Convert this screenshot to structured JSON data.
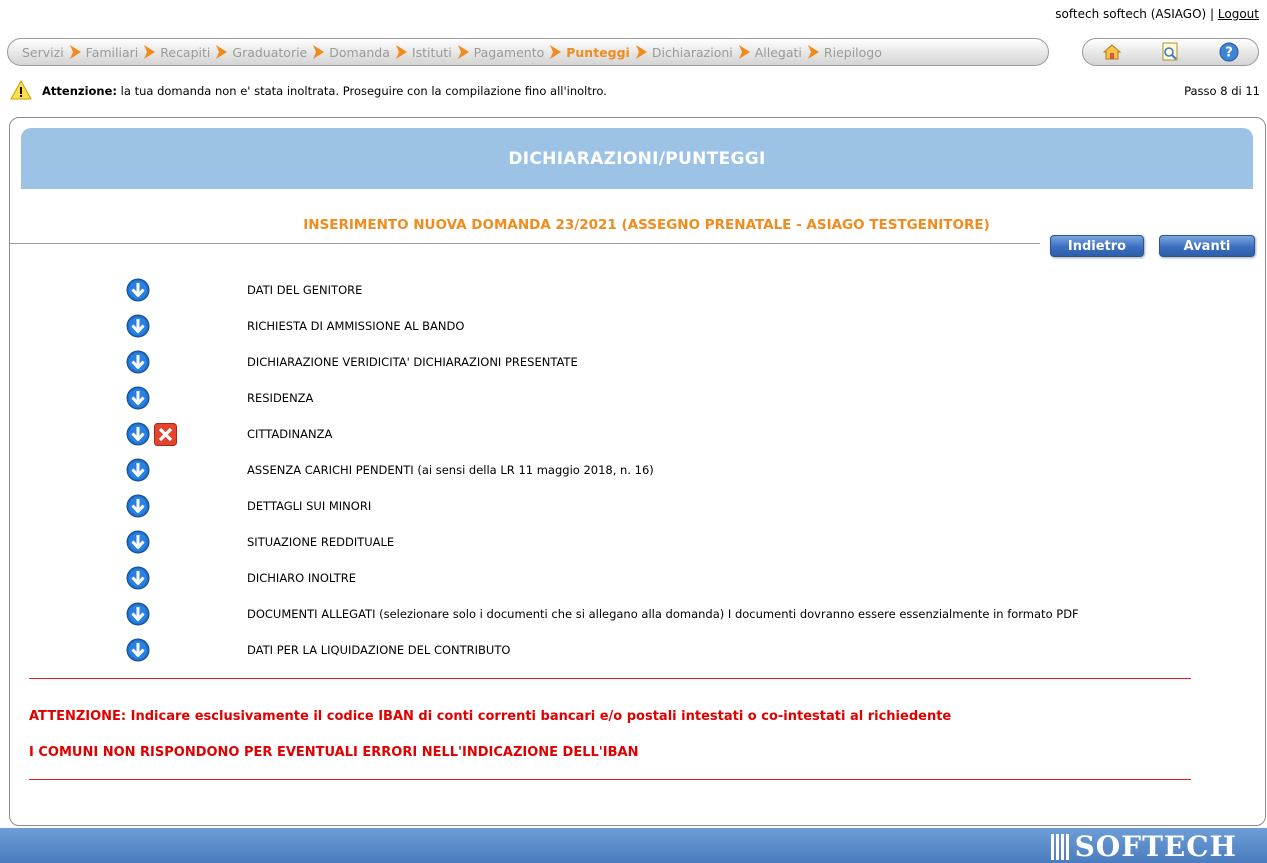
{
  "user": {
    "name": "softech softech (ASIAGO)",
    "separator": "|",
    "logout_label": "Logout"
  },
  "steps": [
    {
      "label": "Servizi",
      "current": false
    },
    {
      "label": "Familiari",
      "current": false
    },
    {
      "label": "Recapiti",
      "current": false
    },
    {
      "label": "Graduatorie",
      "current": false
    },
    {
      "label": "Domanda",
      "current": false
    },
    {
      "label": "Istituti",
      "current": false
    },
    {
      "label": "Pagamento",
      "current": false
    },
    {
      "label": "Punteggi",
      "current": true
    },
    {
      "label": "Dichiarazioni",
      "current": false
    },
    {
      "label": "Allegati",
      "current": false
    },
    {
      "label": "Riepilogo",
      "current": false
    }
  ],
  "tools": [
    "home-icon",
    "search-document-icon",
    "help-icon"
  ],
  "warning": {
    "label": "Attenzione:",
    "text": " la tua domanda non e' stata inoltrata. Proseguire con la compilazione fino all'inoltro.",
    "step_text": "Passo 8 di 11"
  },
  "panel": {
    "title": "DICHIARAZIONI/PUNTEGGI",
    "subtitle": "INSERIMENTO NUOVA DOMANDA 23/2021 (ASSEGNO PRENATALE - ASIAGO TESTGENITORE)",
    "back_label": "Indietro",
    "next_label": "Avanti"
  },
  "items": [
    {
      "label": "DATI DEL GENITORE",
      "error": false
    },
    {
      "label": "RICHIESTA DI AMMISSIONE AL BANDO",
      "error": false
    },
    {
      "label": "DICHIARAZIONE VERIDICITA' DICHIARAZIONI PRESENTATE",
      "error": false
    },
    {
      "label": "RESIDENZA",
      "error": false
    },
    {
      "label": "CITTADINANZA",
      "error": true
    },
    {
      "label": "ASSENZA CARICHI PENDENTI (ai sensi della LR 11 maggio 2018, n. 16)",
      "error": false
    },
    {
      "label": "DETTAGLI SUI MINORI",
      "error": false
    },
    {
      "label": "SITUAZIONE REDDITUALE",
      "error": false
    },
    {
      "label": "DICHIARO INOLTRE",
      "error": false
    },
    {
      "label": "DOCUMENTI ALLEGATI (selezionare solo i documenti che si allegano alla domanda) I documenti dovranno essere essenzialmente in formato PDF",
      "error": false
    },
    {
      "label": "DATI PER LA LIQUIDAZIONE DEL CONTRIBUTO",
      "error": false
    }
  ],
  "notes": {
    "iban_warning": "ATTENZIONE: Indicare esclusivamente il codice IBAN di conti correnti bancari e/o postali intestati o co-intestati al richiedente",
    "iban_disclaimer": "I COMUNI NON RISPONDONO PER EVENTUALI ERRORI NELL'INDICAZIONE DELL'IBAN"
  },
  "footer": {
    "logo_text": "SOFTECH"
  },
  "colors": {
    "accent": "#f08c1e",
    "header_blue": "#9cc3e6",
    "button_blue": "#3b6fc0",
    "alert_red": "#e00000"
  }
}
